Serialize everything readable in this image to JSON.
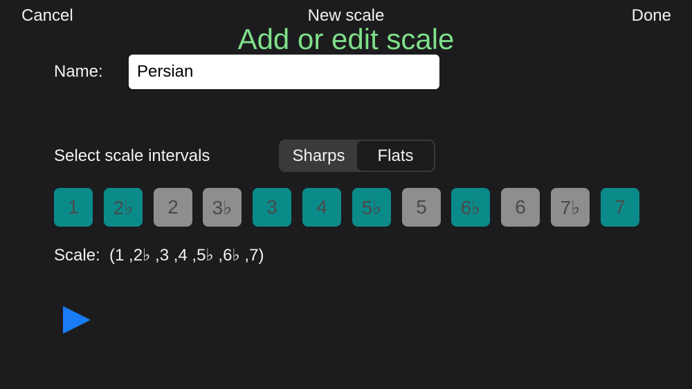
{
  "nav": {
    "cancel_label": "Cancel",
    "title": "New scale",
    "done_label": "Done"
  },
  "caption": "Add or edit scale",
  "form": {
    "name_label": "Name:",
    "name_value": "Persian"
  },
  "intervals": {
    "label": "Select scale intervals",
    "accidentals": {
      "options": [
        "Sharps",
        "Flats"
      ],
      "selected": "Flats"
    },
    "buttons": [
      {
        "label": "1",
        "selected": true
      },
      {
        "label": "2♭",
        "selected": true
      },
      {
        "label": "2",
        "selected": false
      },
      {
        "label": "3♭",
        "selected": false
      },
      {
        "label": "3",
        "selected": true
      },
      {
        "label": "4",
        "selected": true
      },
      {
        "label": "5♭",
        "selected": true
      },
      {
        "label": "5",
        "selected": false
      },
      {
        "label": "6♭",
        "selected": true
      },
      {
        "label": "6",
        "selected": false
      },
      {
        "label": "7♭",
        "selected": false
      },
      {
        "label": "7",
        "selected": true
      }
    ]
  },
  "scale": {
    "label": "Scale:",
    "value": "(1 ,2♭ ,3 ,4 ,5♭ ,6♭ ,7)"
  },
  "player": {
    "icon": "play-icon"
  },
  "colors": {
    "background": "#1c1c1e",
    "caption": "#7fe08a",
    "interval_on": "#0b8a8a",
    "interval_off": "#8e8e8e",
    "play": "#1a7cf5"
  }
}
